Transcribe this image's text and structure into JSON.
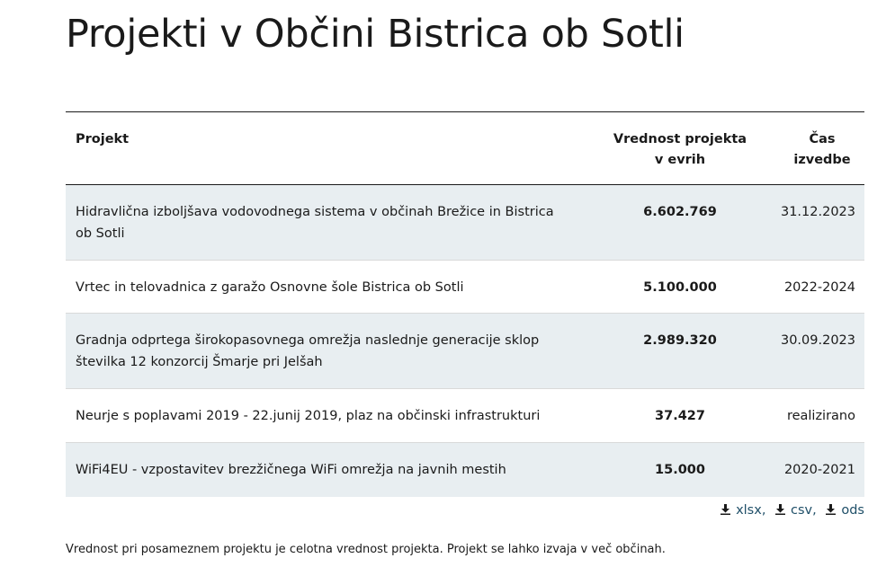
{
  "page": {
    "title": "Projekti v Občini Bistrica ob Sotli"
  },
  "table": {
    "headers": {
      "project": "Projekt",
      "value": "Vrednost projekta v evrih",
      "time": "Čas izvedbe"
    },
    "rows": [
      {
        "project": "Hidravlična izboljšava vodovodnega sistema v občinah Brežice in Bistrica ob Sotli",
        "value": "6.602.769",
        "time": "31.12.2023"
      },
      {
        "project": "Vrtec in telovadnica z garažo Osnovne šole Bistrica ob Sotli",
        "value": "5.100.000",
        "time": "2022-2024"
      },
      {
        "project": "Gradnja odprtega širokopasovnega omrežja naslednje generacije sklop številka 12 konzorcij Šmarje pri Jelšah",
        "value": "2.989.320",
        "time": "30.09.2023"
      },
      {
        "project": "Neurje s poplavami 2019 - 22.junij 2019, plaz na občinski infrastrukturi",
        "value": "37.427",
        "time": "realizirano"
      },
      {
        "project": "WiFi4EU - vzpostavitev brezžičnega WiFi omrežja na javnih mestih",
        "value": "15.000",
        "time": "2020-2021"
      }
    ]
  },
  "downloads": {
    "xlsx": "xlsx",
    "csv": "csv",
    "ods": "ods",
    "separator": ","
  },
  "footnote": "Vrednost pri posameznem projektu je celotna vrednost projekta. Projekt se lahko izvaja v več občinah.",
  "colors": {
    "alt_row": "#e8eef1",
    "link": "#1f4f68"
  },
  "icons": {
    "download": "download-icon"
  }
}
